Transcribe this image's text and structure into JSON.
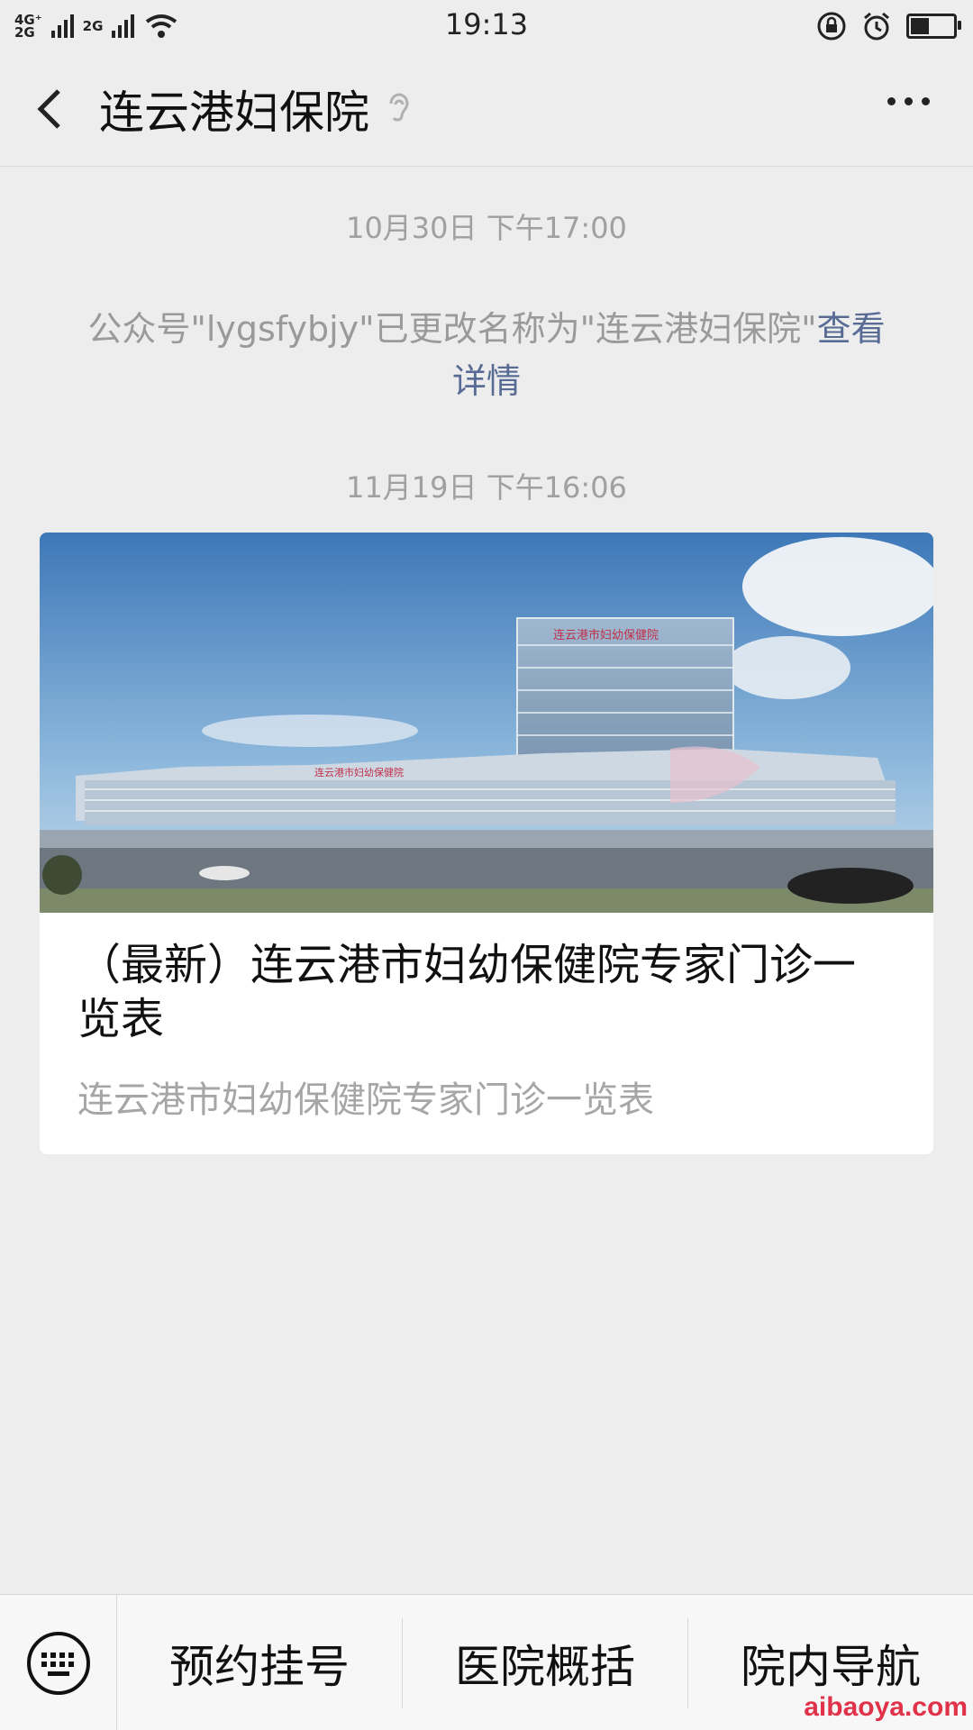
{
  "status_bar": {
    "network_top": "4G⁺",
    "network_bottom": "2G",
    "network_2": "2G",
    "time": "19:13",
    "icons": [
      "wifi-icon",
      "rotation-lock-icon",
      "alarm-icon",
      "battery-icon"
    ]
  },
  "nav": {
    "title": "连云港妇保院",
    "icons": [
      "back-arrow-icon",
      "ear-icon",
      "more-icon"
    ]
  },
  "messages": {
    "timestamp_1": "10月30日 下午17:00",
    "system_text": "公众号\"lygsfybjy\"已更改名称为\"连云港妇保院\"",
    "system_link": "查看详情",
    "timestamp_2": "11月19日 下午16:06"
  },
  "article_card": {
    "title": "（最新）连云港市妇幼保健院专家门诊一览表",
    "digest": "连云港市妇幼保健院专家门诊一览表",
    "image_sign_main": "连云港市妇幼保健院",
    "image_sign_low": "连云港市妇幼保健院"
  },
  "menu": {
    "items": [
      "预约挂号",
      "医院概括",
      "院内导航"
    ],
    "icons": [
      "keyboard-icon"
    ]
  },
  "watermark": "aibaoya.com",
  "colors": {
    "background": "#ededed",
    "link": "#576b95",
    "watermark": "#e0334a"
  }
}
